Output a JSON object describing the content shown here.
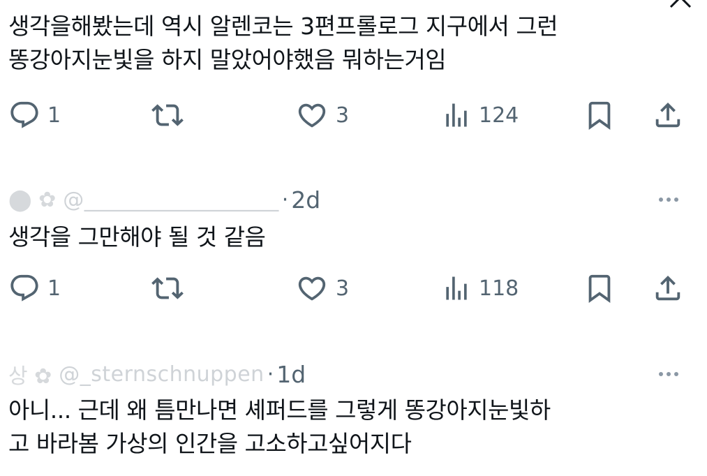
{
  "posts": [
    {
      "text": "생각을해봤는데 역시 알렌코는 3편프롤로그 지구에서 그런\n똥강아지눈빛을 하지 말았어야했음 뭐하는거임",
      "stats": {
        "replies": "1",
        "likes": "3",
        "views": "124"
      }
    },
    {
      "time": "2d",
      "text": "생각을 그만해야 될 것 같음",
      "stats": {
        "replies": "1",
        "likes": "3",
        "views": "118"
      }
    },
    {
      "handle": "@_sternschnuppen",
      "time": "1d",
      "text": "아니... 근데 왜 틈만나면 셰퍼드를 그렇게 똥강아지눈빛하\n고 바라봄 가상의 인간을 고소하고싶어지다"
    }
  ],
  "icons": {
    "reply": "reply-icon",
    "repost": "repost-icon",
    "like": "heart-icon",
    "views": "views-icon",
    "bookmark": "bookmark-icon",
    "share": "share-icon",
    "more": "more-icon",
    "close": "close-icon"
  },
  "colors": {
    "text": "#0f1419",
    "secondary": "#536471",
    "faded": "#cfd3d7"
  }
}
